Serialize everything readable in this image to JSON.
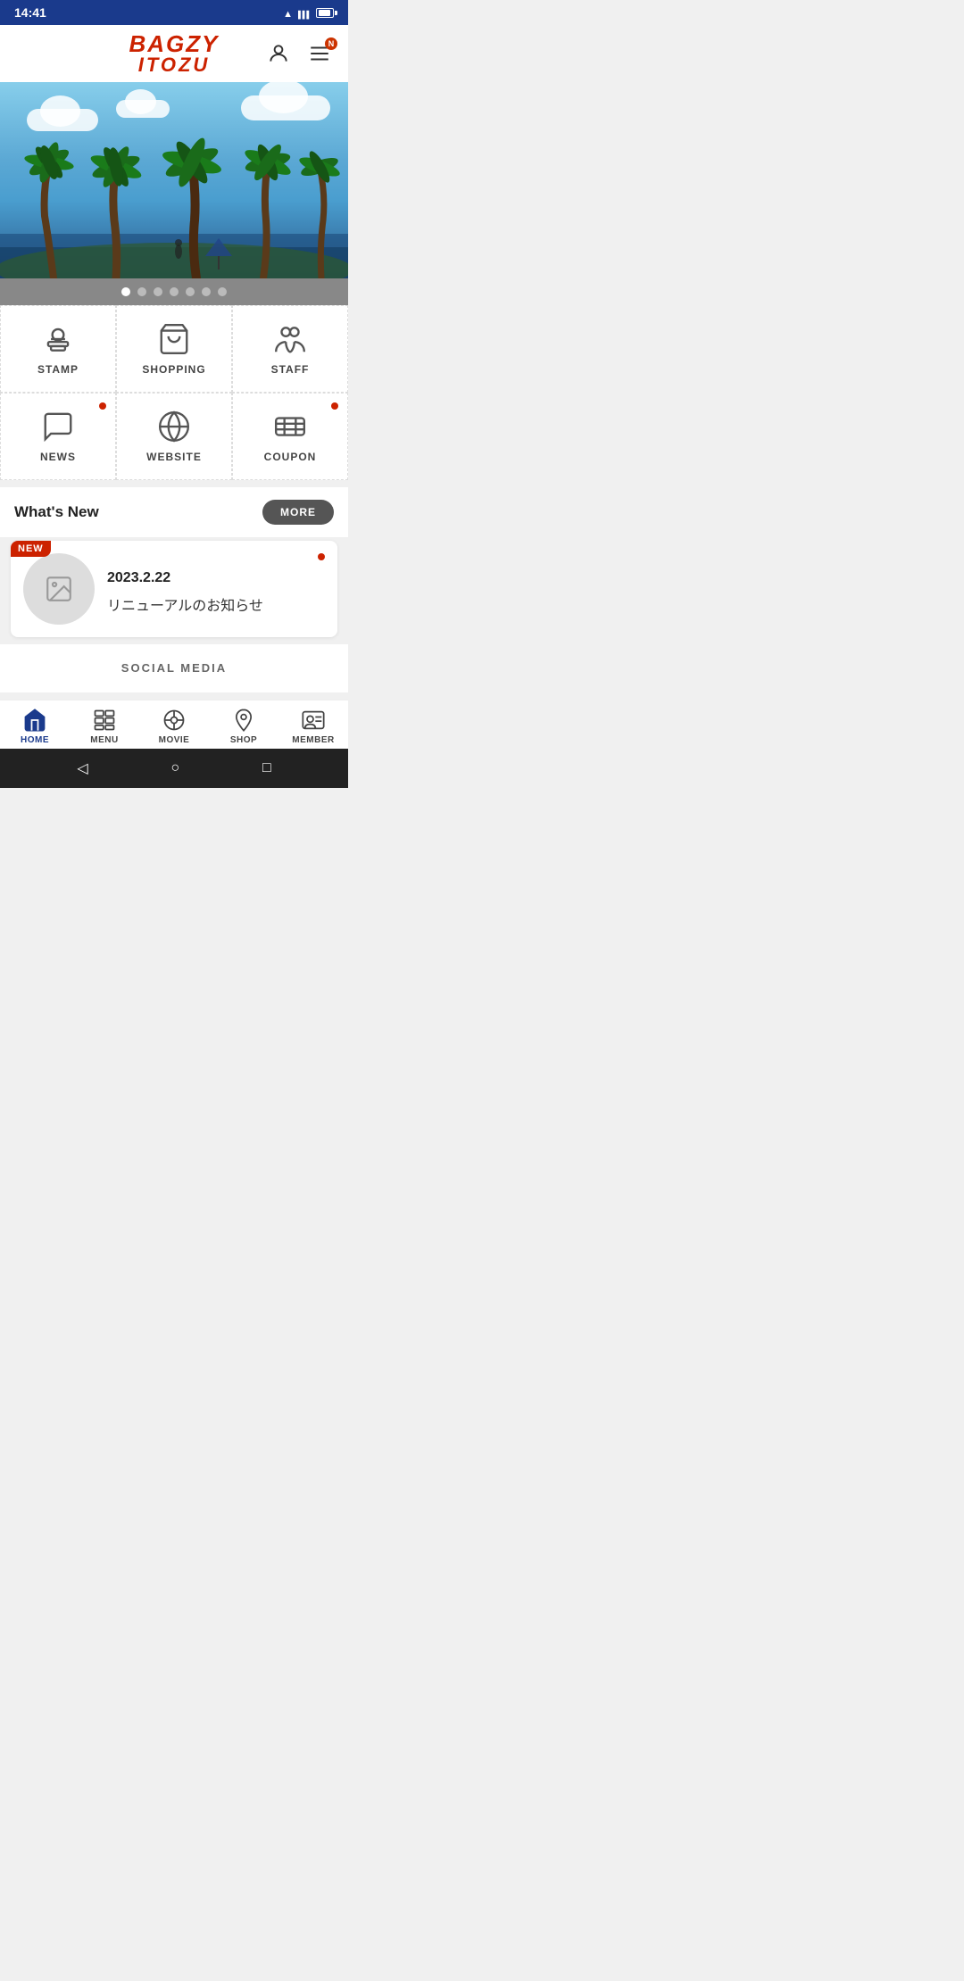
{
  "statusBar": {
    "time": "14:41"
  },
  "header": {
    "logoLine1": "BAGZY",
    "logoLine2": "ITOZU",
    "notificationBadge": "N"
  },
  "carousel": {
    "totalDots": 7,
    "activeDot": 0
  },
  "iconGrid": {
    "items": [
      {
        "id": "stamp",
        "label": "STAMP",
        "hasNewDot": false
      },
      {
        "id": "shopping",
        "label": "SHOPPING",
        "hasNewDot": false
      },
      {
        "id": "staff",
        "label": "STAFF",
        "hasNewDot": false
      },
      {
        "id": "news",
        "label": "NEWS",
        "hasNewDot": true
      },
      {
        "id": "website",
        "label": "WEBSITE",
        "hasNewDot": false
      },
      {
        "id": "coupon",
        "label": "COUPON",
        "hasNewDot": true
      }
    ]
  },
  "whatsNew": {
    "title": "What's New",
    "moreLabel": "MORE"
  },
  "newsCard": {
    "badge": "NEW",
    "date": "2023.2.22",
    "text": "リニューアルのお知らせ",
    "hasNewDot": true
  },
  "socialMedia": {
    "title": "SOCIAL MEDIA"
  },
  "bottomNav": {
    "items": [
      {
        "id": "home",
        "label": "HOME",
        "active": true
      },
      {
        "id": "menu",
        "label": "MENU",
        "active": false
      },
      {
        "id": "movie",
        "label": "MOVIE",
        "active": false
      },
      {
        "id": "shop",
        "label": "SHOP",
        "active": false
      },
      {
        "id": "member",
        "label": "MEMBER",
        "active": false
      }
    ]
  },
  "androidNav": {
    "backSymbol": "◁",
    "homeSymbol": "○",
    "recentSymbol": "□"
  }
}
